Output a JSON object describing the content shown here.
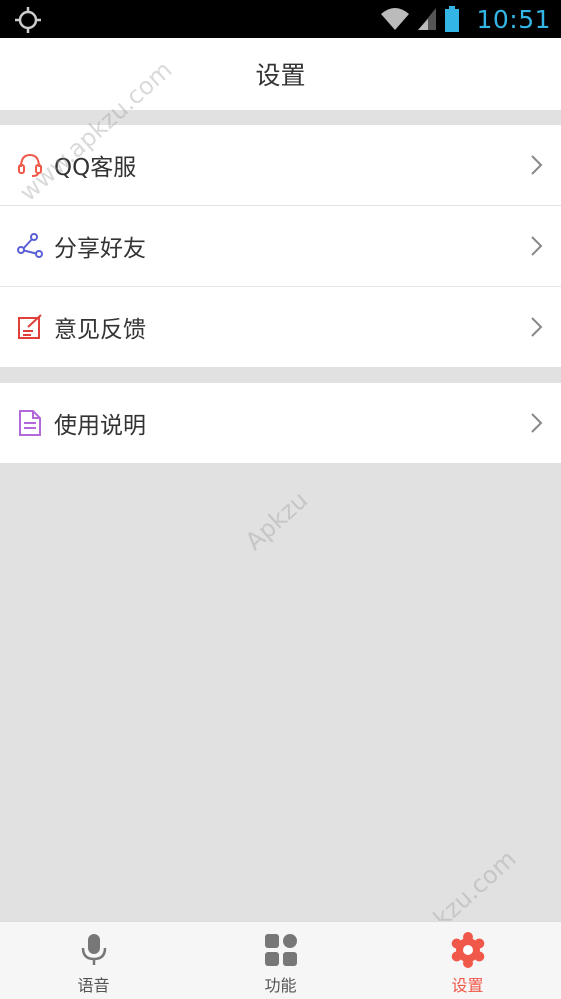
{
  "status_bar": {
    "time": "10:51",
    "icons": [
      "gps-icon",
      "wifi-icon",
      "signal-icon",
      "battery-icon"
    ]
  },
  "header": {
    "title": "设置"
  },
  "settings": {
    "group1": [
      {
        "label": "QQ客服",
        "icon": "headset-icon",
        "color": "#f0584a"
      },
      {
        "label": "分享好友",
        "icon": "share-icon",
        "color": "#5b5fd6"
      },
      {
        "label": "意见反馈",
        "icon": "feedback-icon",
        "color": "#e0403a"
      }
    ],
    "group2": [
      {
        "label": "使用说明",
        "icon": "document-icon",
        "color": "#b36ad8"
      }
    ]
  },
  "watermark": {
    "text_top": "www.apkzu.com",
    "text_mid": "Apkzu",
    "text_bottom": "www.apkzu.com"
  },
  "tabbar": {
    "tabs": [
      {
        "label": "语音",
        "icon": "microphone-icon",
        "active": false
      },
      {
        "label": "功能",
        "icon": "grid-icon",
        "active": false
      },
      {
        "label": "设置",
        "icon": "settings-gear-icon",
        "active": true
      }
    ],
    "active_color": "#f0584a",
    "inactive_color": "#777777"
  }
}
